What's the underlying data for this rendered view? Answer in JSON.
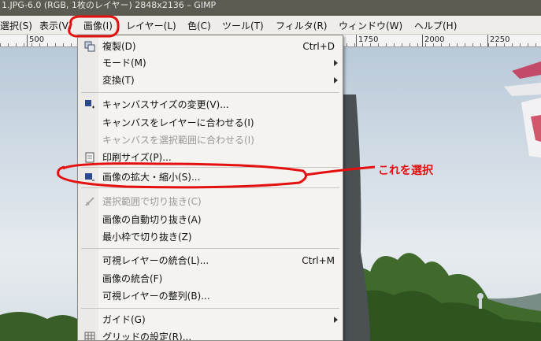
{
  "window": {
    "title": "1.JPG-6.0 (RGB, 1枚のレイヤー) 2848x2136 – GIMP"
  },
  "menubar": {
    "items": [
      {
        "label": "選択(S)"
      },
      {
        "label": "表示(V)"
      },
      {
        "label": "画像(I)"
      },
      {
        "label": "レイヤー(L)"
      },
      {
        "label": "色(C)"
      },
      {
        "label": "ツール(T)"
      },
      {
        "label": "フィルタ(R)"
      },
      {
        "label": "ウィンドウ(W)"
      },
      {
        "label": "ヘルプ(H)"
      }
    ],
    "active_index": 2
  },
  "ruler": {
    "labels": [
      "500",
      "1750",
      "2000",
      "2250"
    ]
  },
  "image_menu": {
    "items": [
      {
        "label": "複製(D)",
        "shortcut": "Ctrl+D",
        "icon": "duplicate-icon"
      },
      {
        "label": "モード(M)",
        "submenu": true
      },
      {
        "label": "変換(T)",
        "submenu": true
      },
      {
        "label": "キャンバスサイズの変更(V)...",
        "icon": "canvas-size-icon"
      },
      {
        "label": "キャンバスをレイヤーに合わせる(I)"
      },
      {
        "label": "キャンバスを選択範囲に合わせる(I)",
        "disabled": true
      },
      {
        "label": "印刷サイズ(P)...",
        "icon": "print-size-icon"
      },
      {
        "label": "画像の拡大・縮小(S)...",
        "icon": "scale-image-icon"
      },
      {
        "label": "選択範囲で切り抜き(C)",
        "disabled": true,
        "icon": "crop-icon"
      },
      {
        "label": "画像の自動切り抜き(A)"
      },
      {
        "label": "最小枠で切り抜き(Z)"
      },
      {
        "label": "可視レイヤーの統合(L)...",
        "shortcut": "Ctrl+M"
      },
      {
        "label": "画像の統合(F)"
      },
      {
        "label": "可視レイヤーの整列(B)..."
      },
      {
        "label": "ガイド(G)",
        "submenu": true
      },
      {
        "label": "グリッドの設定(R)...",
        "icon": "grid-icon"
      }
    ]
  },
  "annotation": {
    "text": "これを選択",
    "color": "#e41010"
  }
}
